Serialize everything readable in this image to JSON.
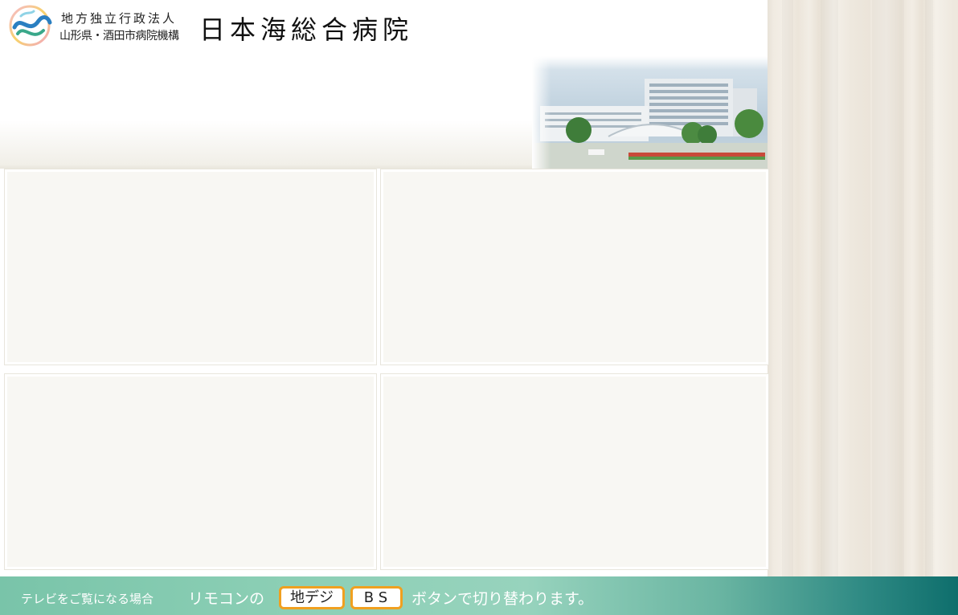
{
  "header": {
    "org_line1": "地方独立行政法人",
    "org_line2": "山形県・酒田市病院機構",
    "hospital_name": "日本海総合病院",
    "logo_icon": "hospital-logo-icon",
    "photo": "hospital-building-photo"
  },
  "panels": [
    {
      "name": "content-panel-top-left"
    },
    {
      "name": "content-panel-top-right"
    },
    {
      "name": "content-panel-bottom-left"
    },
    {
      "name": "content-panel-bottom-right"
    }
  ],
  "footer": {
    "hint": "テレビをご覧になる場合",
    "remote_text": "リモコンの",
    "key_chideji": "地デジ",
    "key_bs": "BS",
    "switch_text": "ボタンで切り替わります。"
  },
  "colors": {
    "footer_start": "#79c4a9",
    "footer_end": "#0e6e6c",
    "key_border": "#f0a020",
    "panel_bg": "#f8f7f3"
  }
}
